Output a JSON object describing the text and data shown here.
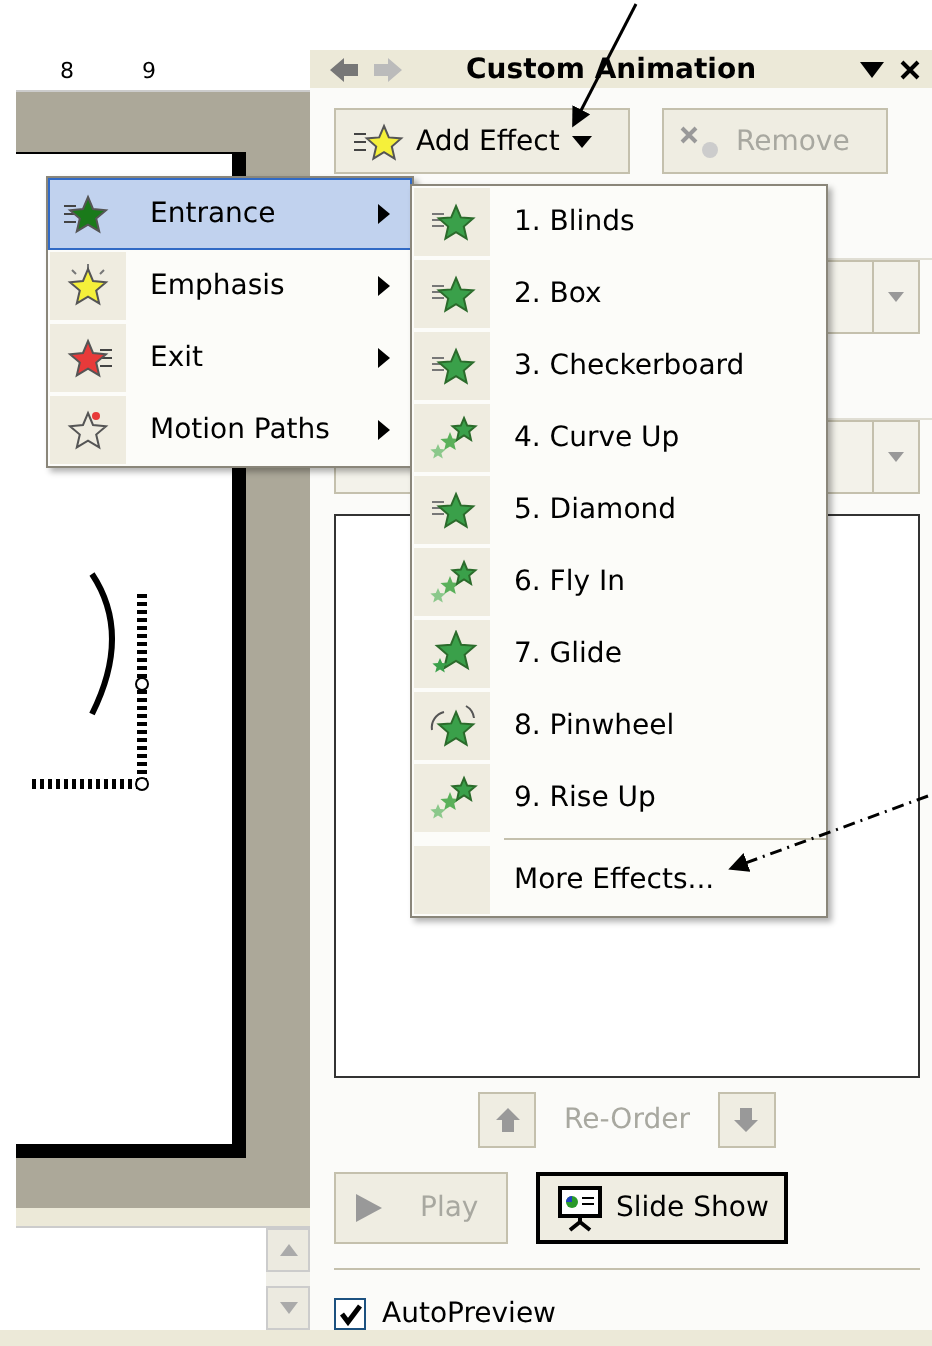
{
  "slide_editor": {
    "ruler_labels": [
      "8",
      "9"
    ]
  },
  "task_pane": {
    "title": "Custom Animation",
    "add_effect_button": "Add Effect",
    "remove_button": {
      "label": "Remove",
      "disabled": true
    },
    "reorder_label": "Re-Order",
    "play_button": {
      "label": "Play",
      "disabled": true
    },
    "slide_show_button": "Slide Show",
    "autopreview": {
      "label": "AutoPreview",
      "checked": true
    }
  },
  "effect_menu": {
    "items": [
      {
        "label": "Entrance",
        "kind": "entrance",
        "selected": true
      },
      {
        "label": "Emphasis",
        "kind": "emphasis",
        "selected": false
      },
      {
        "label": "Exit",
        "kind": "exit",
        "selected": false
      },
      {
        "label": "Motion Paths",
        "kind": "motion",
        "selected": false
      }
    ]
  },
  "entrance_submenu": {
    "items": [
      {
        "label": "1. Blinds",
        "kind": "lines"
      },
      {
        "label": "2. Box",
        "kind": "lines"
      },
      {
        "label": "3. Checkerboard",
        "kind": "lines"
      },
      {
        "label": "4. Curve Up",
        "kind": "trail"
      },
      {
        "label": "5. Diamond",
        "kind": "lines"
      },
      {
        "label": "6. Fly In",
        "kind": "trail"
      },
      {
        "label": "7. Glide",
        "kind": "glide"
      },
      {
        "label": "8. Pinwheel",
        "kind": "pinwheel"
      },
      {
        "label": "9. Rise Up",
        "kind": "trail"
      }
    ],
    "more_item": "More Effects..."
  }
}
